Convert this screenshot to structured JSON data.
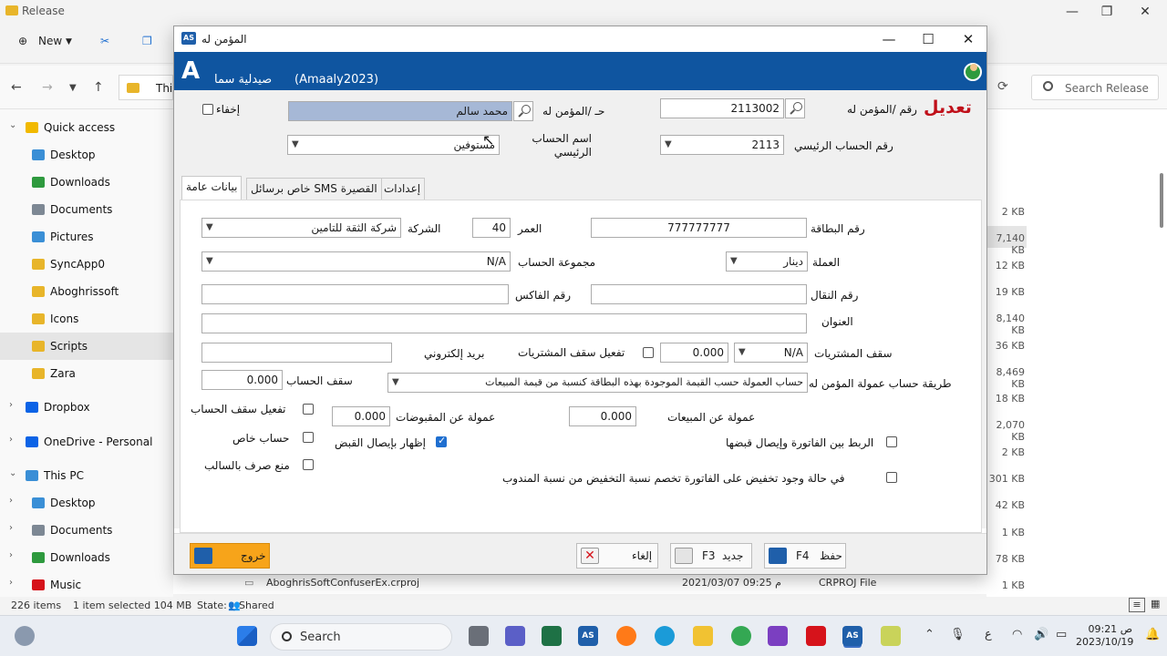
{
  "explorer": {
    "title": "Release",
    "toolbar": {
      "new_label": "New"
    },
    "address": {
      "path_fragment": "This"
    },
    "search_placeholder": "Search Release",
    "sidebar": [
      {
        "label": "Quick access",
        "icon": "star-icon"
      },
      {
        "label": "Desktop",
        "icon": "desktop-icon"
      },
      {
        "label": "Downloads",
        "icon": "download-icon"
      },
      {
        "label": "Documents",
        "icon": "documents-icon"
      },
      {
        "label": "Pictures",
        "icon": "pictures-icon"
      },
      {
        "label": "SyncApp0",
        "icon": "folder-icon"
      },
      {
        "label": "Aboghrissoft",
        "icon": "folder-icon"
      },
      {
        "label": "Icons",
        "icon": "folder-icon"
      },
      {
        "label": "Scripts",
        "icon": "folder-icon"
      },
      {
        "label": "Zara",
        "icon": "folder-icon"
      },
      {
        "label": "Dropbox",
        "icon": "dropbox-icon"
      },
      {
        "label": "OneDrive - Personal",
        "icon": "cloud-icon"
      },
      {
        "label": "This PC",
        "icon": "pc-icon"
      },
      {
        "label": "Desktop",
        "icon": "desktop-icon"
      },
      {
        "label": "Documents",
        "icon": "documents-icon"
      },
      {
        "label": "Downloads",
        "icon": "download-icon"
      },
      {
        "label": "Music",
        "icon": "music-icon"
      }
    ],
    "sizes": [
      "2 KB",
      "7,140 KB",
      "12 KB",
      "19 KB",
      "8,140 KB",
      "36 KB",
      "8,469 KB",
      "18 KB",
      "2,070 KB",
      "2 KB",
      "301 KB",
      "42 KB",
      "1 KB",
      "78 KB",
      "1 KB"
    ],
    "last_row": {
      "name": "AboghrisSoftConfuserEx.crproj",
      "date": "2021/03/07 09:25 م",
      "type": "CRPROJ File"
    },
    "status": {
      "items": "226 items",
      "selected": "1 item selected  104 MB",
      "state_label": "State:",
      "state_value": "Shared"
    }
  },
  "taskbar": {
    "search_label": "Search",
    "time": "09:21 ص",
    "date": "2023/10/19",
    "lang": "ع"
  },
  "app": {
    "window_title": "المؤمن له",
    "logo_letters": "AS",
    "banner": {
      "logo": "A",
      "pharmacy": "صيدلية سما",
      "code": "(Amaaly2023)"
    },
    "mode": "تعديل",
    "header": {
      "insured_no_label": "رقم /المؤمن له",
      "insured_no": "2113002",
      "account_label": "حـ /المؤمن له",
      "account_name": "محمد سالم",
      "hide_label": "إخفاء",
      "main_account_no_label": "رقم الحساب الرئيسي",
      "main_account_no": "2113",
      "main_account_name_label": "اسم الحساب الرئيسي",
      "main_account_name": "مستوفين"
    },
    "tabs": [
      "بيانات عامة",
      "خاص برسائل SMS القصيرة",
      "إعدادات"
    ],
    "general": {
      "card_no_label": "رقم البطاقة",
      "card_no": "777777777",
      "age_label": "العمر",
      "age": "40",
      "company_label": "الشركة",
      "company": "شركة الثقة للتامين",
      "currency_label": "العملة",
      "currency": "دينار",
      "account_group_label": "مجموعة الحساب",
      "account_group": "N/A",
      "mobile_label": "رقم النقال",
      "mobile": "",
      "fax_label": "رقم الفاكس",
      "fax": "",
      "address_label": "العنوان",
      "address": "",
      "purchase_cap_label": "سقف المشتريات",
      "purchase_cap_type": "N/A",
      "purchase_cap_value": "0.000",
      "enable_purchase_cap_label": "تفعيل سقف المشتريات",
      "email_label": "بريد إلكتروني",
      "email": "",
      "commission_method_label": "طريقة حساب عمولة المؤمن له",
      "commission_method": "حساب العمولة حسب القيمة الموجودة بهذه البطاقة كنسبة من قيمة المبيعات",
      "account_cap_label": "سقف الحساب",
      "account_cap": "0.000",
      "enable_account_cap_label": "تفعيل سقف الحساب",
      "sales_commission_label": "عمولة عن المبيعات",
      "sales_commission": "0.000",
      "receipts_commission_label": "عمولة عن المقبوضات",
      "receipts_commission": "0.000",
      "private_account_label": "حساب خاص",
      "show_receipt_label": "إظهار بإيصال القبض",
      "link_invoice_label": "الربط بين الفاتورة وإيصال قبضها",
      "prevent_negative_label": "منع صرف بالسالب",
      "discount_rule_label": "في حالة وجود تخفيض على الفاتورة تخصم نسبة التخفيض من نسبة المندوب"
    },
    "footer": {
      "exit_label": "خروج",
      "cancel_label": "إلغاء",
      "new_label": "جديد",
      "new_key": "F3",
      "save_label": "حفظ",
      "save_key": "F4"
    },
    "colors": {
      "banner": "#0f55a0",
      "mode": "#c0101a",
      "exit": "#f7a41a"
    }
  }
}
